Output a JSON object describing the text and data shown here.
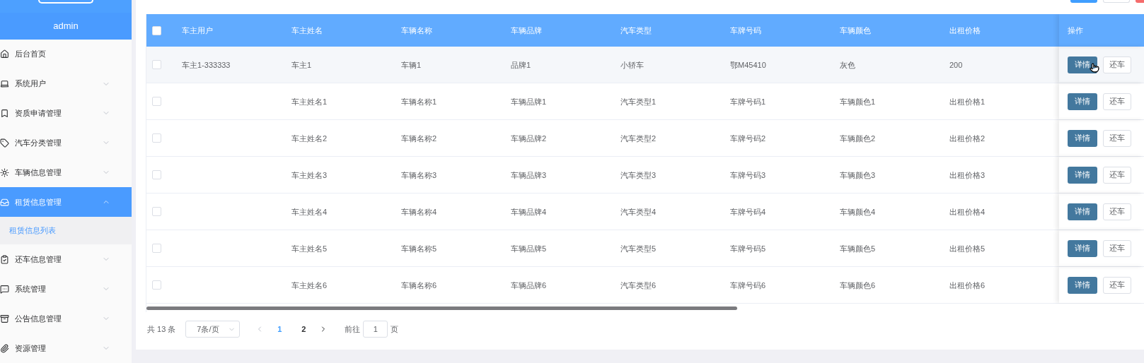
{
  "sidebar": {
    "user": "admin",
    "items": [
      {
        "label": "后台首页",
        "has_children": false,
        "expanded": false,
        "selected": false
      },
      {
        "label": "系统用户",
        "has_children": true,
        "expanded": false,
        "selected": false
      },
      {
        "label": "资质申请管理",
        "has_children": true,
        "expanded": false,
        "selected": false
      },
      {
        "label": "汽车分类管理",
        "has_children": true,
        "expanded": false,
        "selected": false
      },
      {
        "label": "车辆信息管理",
        "has_children": true,
        "expanded": false,
        "selected": false
      },
      {
        "label": "租赁信息管理",
        "has_children": true,
        "expanded": true,
        "selected": true,
        "children": [
          {
            "label": "租赁信息列表",
            "selected": true
          }
        ]
      },
      {
        "label": "还车信息管理",
        "has_children": true,
        "expanded": false,
        "selected": false
      },
      {
        "label": "系统管理",
        "has_children": true,
        "expanded": false,
        "selected": false
      },
      {
        "label": "公告信息管理",
        "has_children": true,
        "expanded": false,
        "selected": false
      },
      {
        "label": "资源管理",
        "has_children": true,
        "expanded": false,
        "selected": false
      }
    ]
  },
  "table": {
    "all_checked": false,
    "columns": [
      "车主用户",
      "车主姓名",
      "车辆名称",
      "车辆品牌",
      "汽车类型",
      "车牌号码",
      "车辆颜色",
      "出租价格",
      "操作"
    ],
    "rows": [
      {
        "checked": false,
        "highlighted": true,
        "cells": [
          "车主1-333333",
          "车主1",
          "车辆1",
          "品牌1",
          "小轿车",
          "鄂M45410",
          "灰色",
          "200"
        ],
        "actions": [
          "详情",
          "还车"
        ]
      },
      {
        "checked": false,
        "highlighted": false,
        "cells": [
          "",
          "车主姓名1",
          "车辆名称1",
          "车辆品牌1",
          "汽车类型1",
          "车牌号码1",
          "车辆颜色1",
          "出租价格1"
        ],
        "actions": [
          "详情",
          "还车"
        ]
      },
      {
        "checked": false,
        "highlighted": false,
        "cells": [
          "",
          "车主姓名2",
          "车辆名称2",
          "车辆品牌2",
          "汽车类型2",
          "车牌号码2",
          "车辆颜色2",
          "出租价格2"
        ],
        "actions": [
          "详情",
          "还车"
        ]
      },
      {
        "checked": false,
        "highlighted": false,
        "cells": [
          "",
          "车主姓名3",
          "车辆名称3",
          "车辆品牌3",
          "汽车类型3",
          "车牌号码3",
          "车辆颜色3",
          "出租价格3"
        ],
        "actions": [
          "详情",
          "还车"
        ]
      },
      {
        "checked": false,
        "highlighted": false,
        "cells": [
          "",
          "车主姓名4",
          "车辆名称4",
          "车辆品牌4",
          "汽车类型4",
          "车牌号码4",
          "车辆颜色4",
          "出租价格4"
        ],
        "actions": [
          "详情",
          "还车"
        ]
      },
      {
        "checked": false,
        "highlighted": false,
        "cells": [
          "",
          "车主姓名5",
          "车辆名称5",
          "车辆品牌5",
          "汽车类型5",
          "车牌号码5",
          "车辆颜色5",
          "出租价格5"
        ],
        "actions": [
          "详情",
          "还车"
        ]
      },
      {
        "checked": false,
        "highlighted": false,
        "cells": [
          "",
          "车主姓名6",
          "车辆名称6",
          "车辆品牌6",
          "汽车类型6",
          "车牌号码6",
          "车辆颜色6",
          "出租价格6"
        ],
        "actions": [
          "详情",
          "还车"
        ]
      }
    ]
  },
  "pagination": {
    "total": "共 13 条",
    "page_size": "7条/页",
    "pages": [
      {
        "label": "1",
        "selected": true
      },
      {
        "label": "2",
        "selected": false
      }
    ],
    "goto_label": "前往",
    "goto_value": "1",
    "goto_suffix": "页"
  }
}
